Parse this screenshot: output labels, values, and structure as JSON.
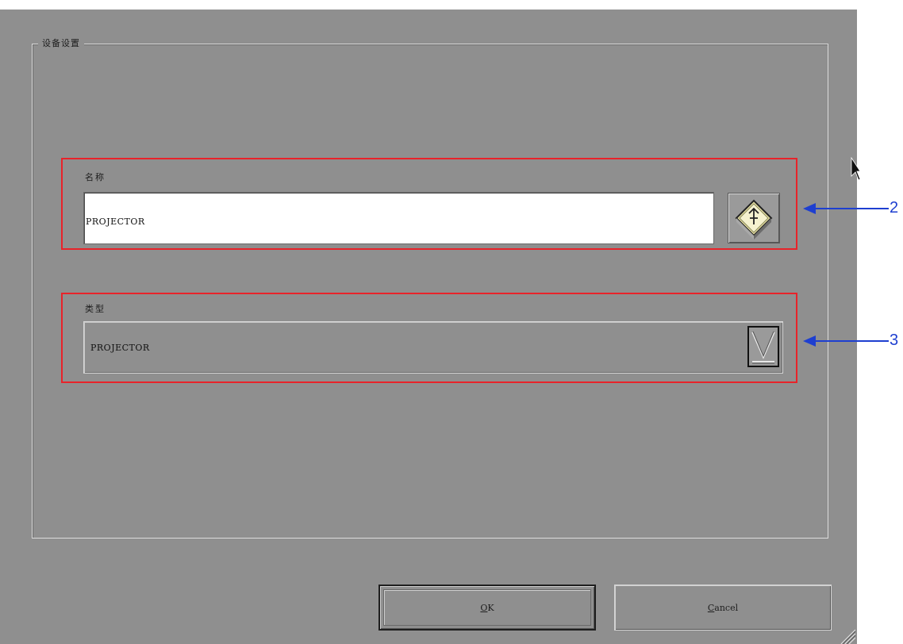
{
  "group": {
    "title": "设备设置"
  },
  "name_field": {
    "label": "名称",
    "value": "PROJECTOR"
  },
  "type_field": {
    "label": "类型",
    "value": "PROJECTOR"
  },
  "buttons": {
    "ok_label": "OK",
    "ok_mnemonic": "O",
    "ok_rest": "K",
    "cancel_label": "Cancel",
    "cancel_mnemonic": "C",
    "cancel_rest": "ancel"
  },
  "callouts": [
    {
      "number": "2",
      "target": "name_field"
    },
    {
      "number": "3",
      "target": "type_field"
    }
  ],
  "icons": {
    "keyboard_button": "keyboard-icon",
    "dropdown": "chevron-down-icon",
    "grip": "resize-grip-icon"
  },
  "colors": {
    "dialog_bg": "#8f8f8f",
    "annotation_box": "#e8232a",
    "callout_arrow": "#1e3fd0"
  }
}
